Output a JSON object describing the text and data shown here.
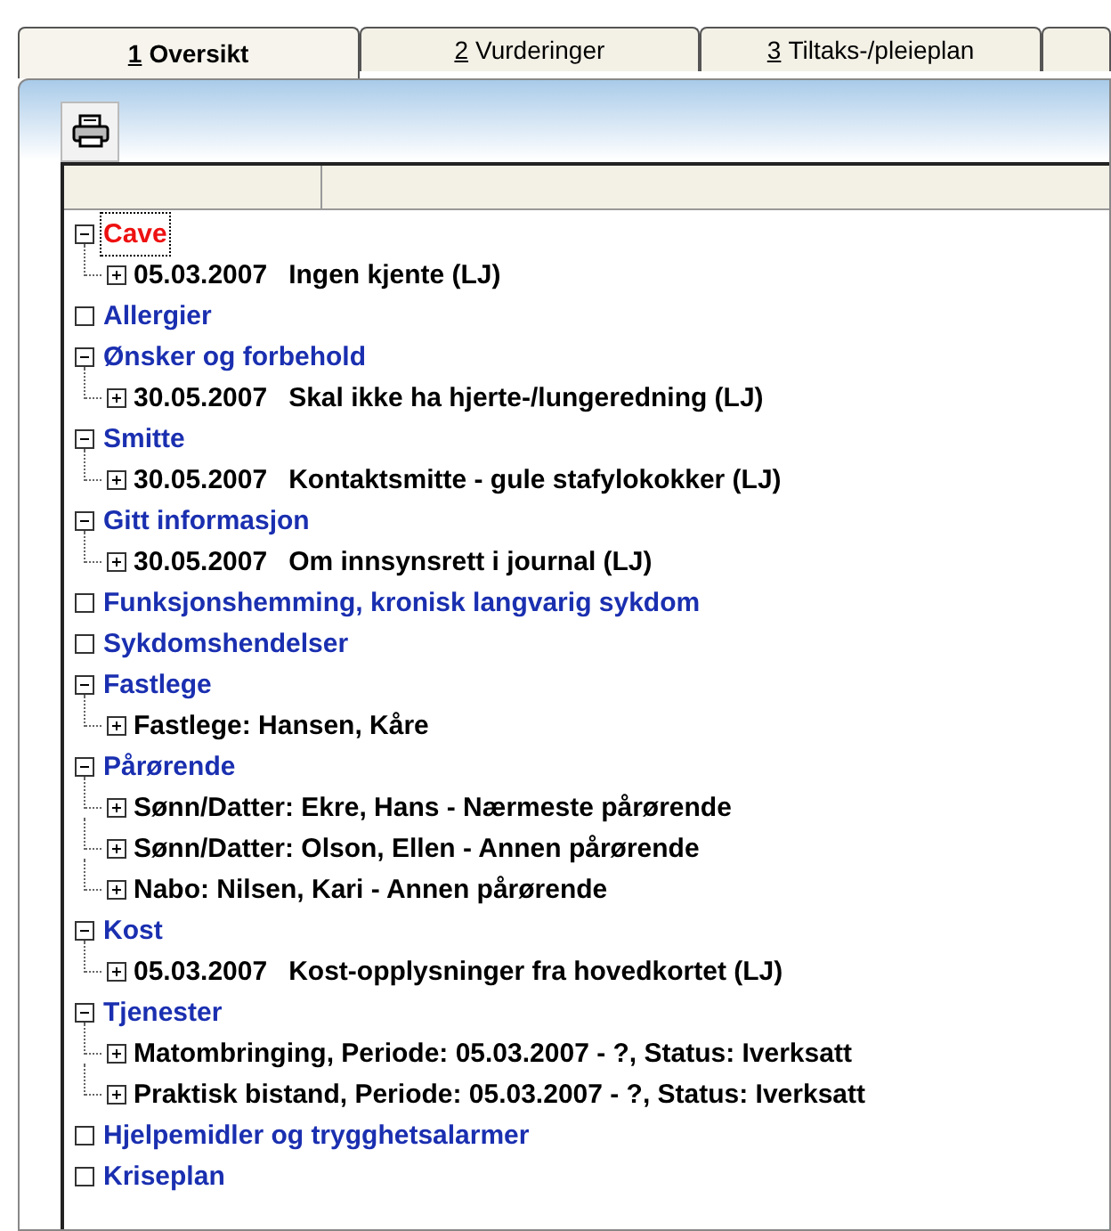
{
  "tabs": [
    {
      "key": "1",
      "label": "Oversikt",
      "selected": true
    },
    {
      "key": "2",
      "label": "Vurderinger",
      "selected": false
    },
    {
      "key": "3",
      "label": "Tiltaks-/pleieplan",
      "selected": false
    }
  ],
  "tree": [
    {
      "label": "Cave",
      "color": "#ee1111",
      "selected": true,
      "expanded": true,
      "children": [
        {
          "date": "05.03.2007",
          "text": "Ingen kjente (LJ)",
          "expanded": false
        }
      ]
    },
    {
      "label": "Allergier",
      "color": "#1a2fb0",
      "selected": false,
      "expanded": false
    },
    {
      "label": "Ønsker og forbehold",
      "color": "#1a2fb0",
      "selected": false,
      "expanded": true,
      "children": [
        {
          "date": "30.05.2007",
          "text": "Skal ikke ha hjerte-/lungeredning (LJ)",
          "expanded": false
        }
      ]
    },
    {
      "label": "Smitte",
      "color": "#1a2fb0",
      "selected": false,
      "expanded": true,
      "children": [
        {
          "date": "30.05.2007",
          "text": "Kontaktsmitte - gule stafylokokker (LJ)",
          "expanded": false
        }
      ]
    },
    {
      "label": "Gitt informasjon",
      "color": "#1a2fb0",
      "selected": false,
      "expanded": true,
      "children": [
        {
          "date": "30.05.2007",
          "text": "Om innsynsrett i journal (LJ)",
          "expanded": false
        }
      ]
    },
    {
      "label": "Funksjonshemming, kronisk langvarig sykdom",
      "color": "#1a2fb0",
      "selected": false,
      "expanded": false
    },
    {
      "label": "Sykdomshendelser",
      "color": "#1a2fb0",
      "selected": false,
      "expanded": false
    },
    {
      "label": "Fastlege",
      "color": "#1a2fb0",
      "selected": false,
      "expanded": true,
      "children": [
        {
          "text": "Fastlege: Hansen, Kåre",
          "expanded": false
        }
      ]
    },
    {
      "label": "Pårørende",
      "color": "#1a2fb0",
      "selected": false,
      "expanded": true,
      "children": [
        {
          "text": "Sønn/Datter: Ekre, Hans - Nærmeste pårørende",
          "expanded": false
        },
        {
          "text": "Sønn/Datter: Olson, Ellen - Annen pårørende",
          "expanded": false
        },
        {
          "text": "Nabo: Nilsen, Kari - Annen pårørende",
          "expanded": false
        }
      ]
    },
    {
      "label": "Kost",
      "color": "#1a2fb0",
      "selected": false,
      "expanded": true,
      "children": [
        {
          "date": "05.03.2007",
          "text": "Kost-opplysninger fra hovedkortet (LJ)",
          "expanded": false
        }
      ]
    },
    {
      "label": "Tjenester",
      "color": "#1a2fb0",
      "selected": false,
      "expanded": true,
      "children": [
        {
          "text": "Matombringing, Periode: 05.03.2007 - ?, Status: Iverksatt",
          "expanded": false
        },
        {
          "text": "Praktisk bistand, Periode: 05.03.2007 - ?, Status: Iverksatt",
          "expanded": false
        }
      ]
    },
    {
      "label": "Hjelpemidler og trygghetsalarmer",
      "color": "#1a2fb0",
      "selected": false,
      "expanded": false
    },
    {
      "label": "Kriseplan",
      "color": "#1a2fb0",
      "selected": false,
      "expanded": false
    }
  ]
}
